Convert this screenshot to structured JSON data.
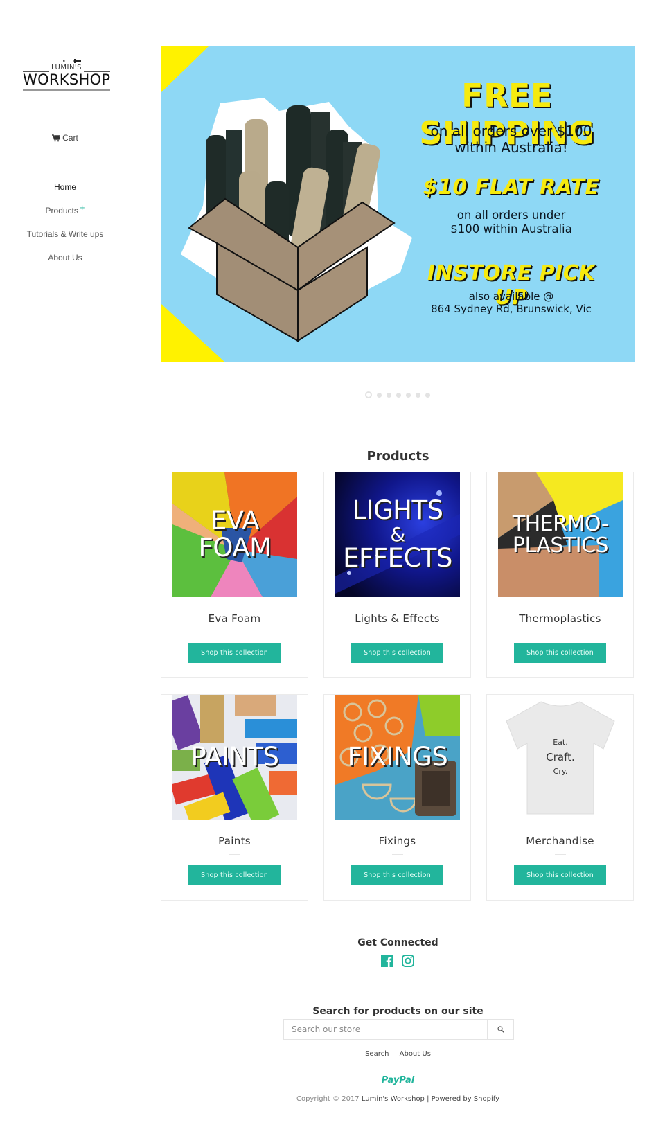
{
  "sidebar": {
    "logo": {
      "top_text": "LUMIN'S",
      "main_text": "WORKSHOP"
    },
    "cart_label": "Cart",
    "nav": [
      {
        "label": "Home",
        "active": true
      },
      {
        "label": "Products",
        "expandable": true,
        "expand_icon": "+"
      },
      {
        "label": "Tutorials & Write ups"
      },
      {
        "label": "About Us"
      }
    ]
  },
  "banner": {
    "headline1": "FREE SHIPPING",
    "body1_line1": "on all orders over $100",
    "body1_line2": "within Australia!",
    "headline2": "$10 FLAT RATE",
    "body2_line1": "on all orders under",
    "body2_line2": "$100 within Australia",
    "headline3": "INSTORE PICK UP",
    "body3_line1": "also available @",
    "body3_line2": "864 Sydney Rd, Brunswick, Vic",
    "colors": {
      "background": "#8ed8f5",
      "headline": "#f6ea0e",
      "corner": "#fff200"
    },
    "slides_total": 7,
    "active_slide": 1
  },
  "products_section": {
    "title": "Products",
    "cards": [
      {
        "name": "Eva Foam",
        "image_text": [
          "EVA",
          "FOAM"
        ],
        "button": "Shop this collection"
      },
      {
        "name": "Lights & Effects",
        "image_text": [
          "LIGHTS",
          "&",
          "EFFECTS"
        ],
        "button": "Shop this collection"
      },
      {
        "name": "Thermoplastics",
        "image_text": [
          "THERMO-",
          "PLASTICS"
        ],
        "button": "Shop this collection"
      },
      {
        "name": "Paints",
        "image_text": [
          "PAINTS"
        ],
        "button": "Shop this collection"
      },
      {
        "name": "Fixings",
        "image_text": [
          "FIXINGS"
        ],
        "button": "Shop this collection"
      },
      {
        "name": "Merchandise",
        "image_text": [
          "Eat.",
          "Craft.",
          "Cry."
        ],
        "button": "Shop this collection"
      }
    ]
  },
  "footer": {
    "connected_title": "Get Connected",
    "social": [
      "facebook-icon",
      "instagram-icon"
    ],
    "search_title": "Search for products on our site",
    "search_placeholder": "Search our store",
    "links": [
      "Search",
      "About Us"
    ],
    "payment": "PayPal",
    "copyright_prefix": "Copyright © 2017",
    "store_name": "Lumin's Workshop",
    "separator": "|",
    "powered_by": "Powered by Shopify",
    "accent_color": "#22b59c"
  }
}
